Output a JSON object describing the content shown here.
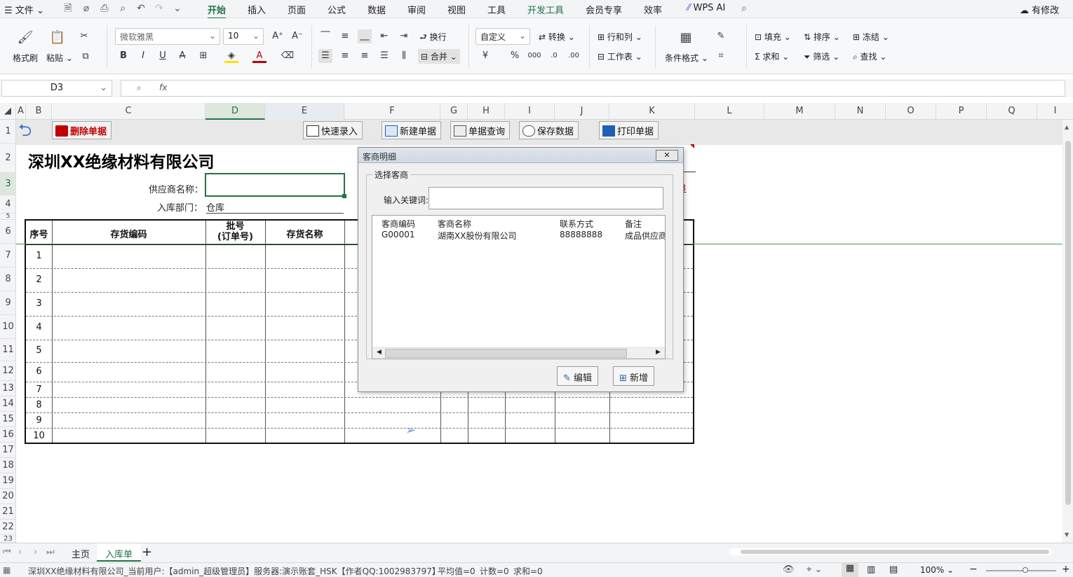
{
  "menubar": {
    "file": "文件",
    "tabs": [
      "开始",
      "插入",
      "页面",
      "公式",
      "数据",
      "审阅",
      "视图",
      "工具",
      "开发工具",
      "会员专享",
      "效率"
    ],
    "wps_ai": "WPS AI",
    "modified": "有修改"
  },
  "ribbon": {
    "format_painter": "格式刷",
    "paste": "粘贴",
    "font_name": "微软雅黑",
    "font_size": "10",
    "wrap": "换行",
    "number_format": "自定义",
    "convert": "转换",
    "row_col": "行和列",
    "merge": "合并",
    "worksheet": "工作表",
    "conditional": "条件格式",
    "fill": "填充",
    "sort": "排序",
    "freeze": "冻结",
    "sum": "求和",
    "filter": "筛选",
    "find": "查找"
  },
  "formula": {
    "cell_ref": "D3",
    "fx": "fx",
    "value": ""
  },
  "columns": [
    "A",
    "B",
    "C",
    "D",
    "E",
    "F",
    "G",
    "H",
    "I",
    "J",
    "K",
    "L",
    "M",
    "N",
    "O",
    "P",
    "Q",
    "I"
  ],
  "rows": [
    "1",
    "2",
    "3",
    "4",
    "5",
    "6",
    "7",
    "8",
    "9",
    "10",
    "11",
    "12",
    "13",
    "14",
    "15",
    "16",
    "17",
    "18",
    "19",
    "20",
    "21",
    "22",
    "23"
  ],
  "sheet_buttons": {
    "delete": "删除单据",
    "quick": "快速录入",
    "new": "新建单据",
    "query": "单据查询",
    "save": "保存数据",
    "print": "打印单据"
  },
  "form": {
    "company": "深圳XX绝缘材料有限公司",
    "supplier_label": "供应商名称：",
    "supplier_value": "",
    "dept_label": "入库部门：",
    "dept_value": "仓库",
    "stray_char": "3"
  },
  "table": {
    "headers": {
      "seq": "序号",
      "code": "存货编码",
      "batch1": "批号",
      "batch2": "(订单号)",
      "name": "存货名称"
    },
    "rows": [
      "1",
      "2",
      "3",
      "4",
      "5",
      "6",
      "7",
      "8",
      "9",
      "10"
    ]
  },
  "dialog": {
    "title": "客商明细",
    "group": "选择客商",
    "keyword_label": "输入关键词:",
    "keyword_value": "",
    "columns": [
      "客商编码",
      "客商名称",
      "联系方式",
      "备注"
    ],
    "records": [
      {
        "code": "G00001",
        "name": "湖南XX股份有限公司",
        "contact": "88888888",
        "note": "成品供应商"
      }
    ],
    "edit": "编辑",
    "add": "新增"
  },
  "sheets": {
    "tabs": [
      "主页",
      "入库单"
    ],
    "active": "入库单"
  },
  "status": {
    "text": "深圳XX绝缘材料有限公司_当前用户:【admin_超级管理员】服务器:演示账套_HSK【作者QQ:1002983797】",
    "avg": "平均值=0",
    "count": "计数=0",
    "sum": "求和=0",
    "zoom": "100%"
  },
  "colors": {
    "accent": "#217346",
    "red": "#c00000",
    "blue": "#1f5fb5"
  }
}
